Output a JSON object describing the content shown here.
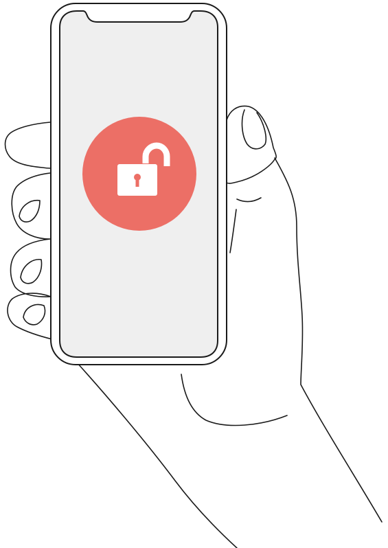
{
  "illustration": {
    "subject": "hand-holding-phone",
    "icon": "unlocked-padlock-icon",
    "colors": {
      "background": "#ffffff",
      "outline": "#1a1a1a",
      "phone_body": "#ffffff",
      "screen": "#efefef",
      "badge": "#ec6f66",
      "padlock": "#ffffff",
      "keyhole": "#ec6f66"
    }
  }
}
